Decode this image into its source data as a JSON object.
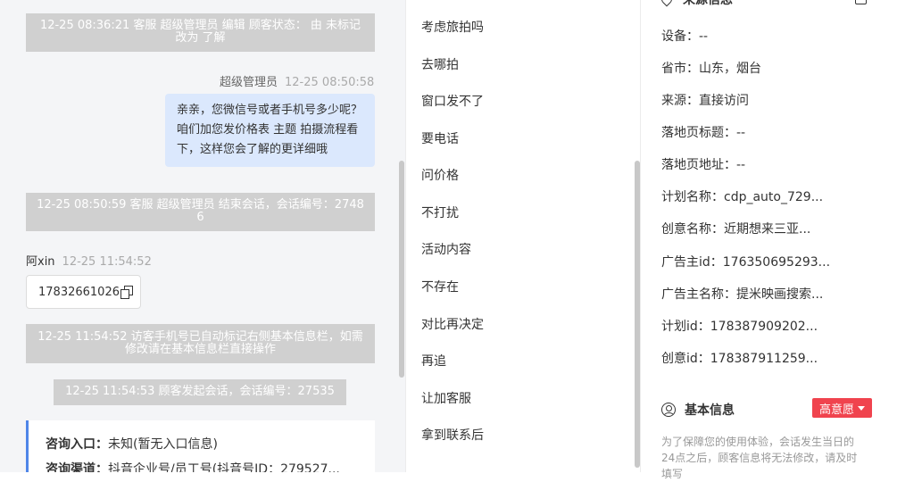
{
  "chat": {
    "sys1": "12-25 08:36:21 客服 超级管理员 编辑 顾客状态： 由 未标记 改为 了解",
    "agent_name": "超级管理员",
    "agent_time": "12-25 08:50:58",
    "agent_msg": "亲亲，您微信号或者手机号多少呢？咱们加您发价格表 主题 拍摄流程看下，这样您会了解的更详细哦",
    "sys2": "12-25 08:50:59 客服 超级管理员 结束会话，会话编号：27486",
    "customer_name": "阿xin",
    "customer_time": "12-25 11:54:52",
    "customer_phone": "17832661026",
    "sys3": "12-25 11:54:52 访客手机号已自动标记右侧基本信息栏，如需修改请在基本信息栏直接操作",
    "sys4": "12-25 11:54:53 顾客发起会话，会话编号：27535",
    "card": {
      "entry_label": "咨询入口：",
      "entry_value": "未知(暂无入口信息)",
      "channel_label": "咨询渠道：",
      "channel_value": "抖音企业号/员工号(抖音号ID：279527..."
    }
  },
  "quick_replies": [
    "考虑旅拍吗",
    "去哪拍",
    "窗口发不了",
    "要电话",
    "问价格",
    "不打扰",
    "活动内容",
    "不存在",
    "对比再决定",
    "再追",
    "让加客服",
    "拿到联系后"
  ],
  "info": {
    "source_title": "来源信息",
    "device": "设备：--",
    "province": "省市：山东，烟台",
    "origin": "来源：直接访问",
    "landing_title": "落地页标题：--",
    "landing_url": "落地页地址：--",
    "plan_name": "计划名称：cdp_auto_729...",
    "creative_name": "创意名称：近期想来三亚...",
    "advertiser_id": "广告主id：176350695293...",
    "advertiser_name": "广告主名称：提米映画搜索...",
    "plan_id": "计划id：178387909202...",
    "creative_id": "创意id：178387911259...",
    "basic_title": "基本信息",
    "intent_badge": "高意愿",
    "notice": "为了保障您的使用体验，会话发生当日的24点之后，顾客信息将无法修改，请及时填写"
  },
  "colors": {
    "accent": "#4f86e8",
    "badge": "#f0434e",
    "bubble": "#dbe8fd"
  }
}
